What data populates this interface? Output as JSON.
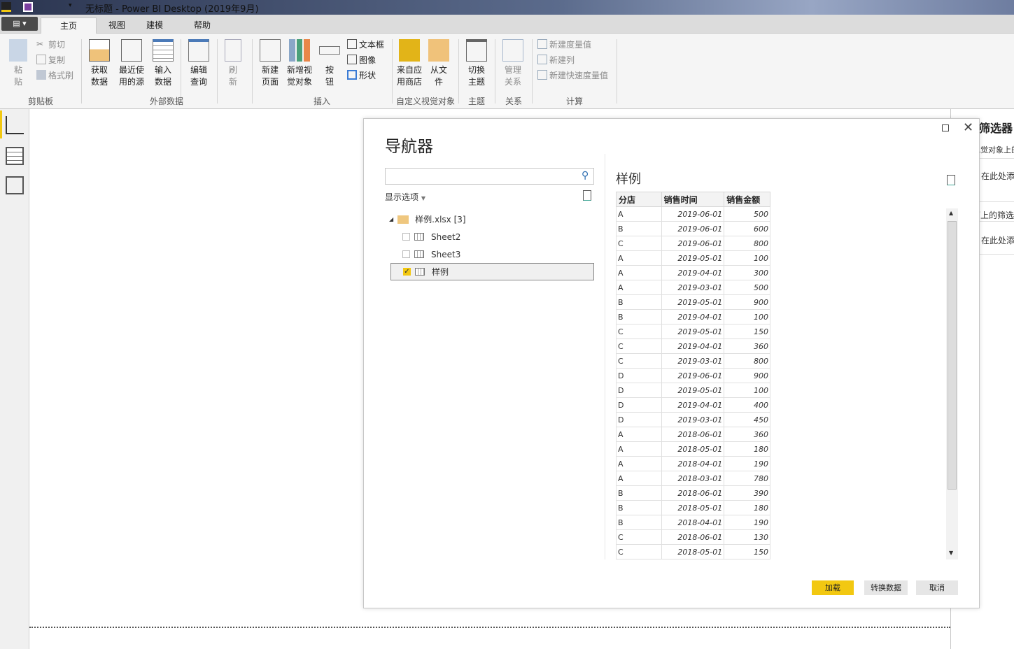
{
  "window": {
    "title": "无标题 - Power BI Desktop (2019年9月)"
  },
  "tabs": [
    "主页",
    "视图",
    "建模",
    "帮助"
  ],
  "ribbon": {
    "clipboard": {
      "paste": "粘贴",
      "cut": "剪切",
      "copy": "复制",
      "format_painter": "格式刷",
      "label": "剪贴板"
    },
    "external": {
      "get_data": "获取数据",
      "recent": "最近使用的源",
      "enter_data": "输入数据",
      "edit_query": "编辑查询",
      "refresh": "刷新",
      "label": "外部数据"
    },
    "insert": {
      "new_page": "新建页面",
      "new_visual": "新增视觉对象",
      "button": "按钮",
      "textbox": "文本框",
      "image": "图像",
      "shapes": "形状",
      "label": "插入"
    },
    "custom": {
      "from_store": "来自应用商店",
      "from_file": "从文件",
      "label": "自定义视觉对象"
    },
    "theme": {
      "switch": "切换主题",
      "label": "主题"
    },
    "relations": {
      "manage": "管理关系",
      "label": "关系"
    },
    "calc": {
      "new_measure": "新建度量值",
      "new_column": "新建列",
      "new_quick_measure": "新建快速度量值",
      "label": "计算"
    }
  },
  "filter_pane": {
    "title": "筛选器",
    "s1": "此视觉对象上的筛选器",
    "add1": "在此处添加",
    "s2": "此页面上的筛选器",
    "add2": "在此处添加"
  },
  "navigator": {
    "title": "导航器",
    "search_placeholder": "",
    "display_options": "显示选项",
    "file": "样例.xlsx [3]",
    "items": [
      {
        "label": "Sheet2",
        "checked": false
      },
      {
        "label": "Sheet3",
        "checked": false
      },
      {
        "label": "样例",
        "checked": true
      }
    ],
    "preview_title": "样例",
    "columns": [
      "分店",
      "销售时间",
      "销售金额"
    ],
    "rows": [
      [
        "A",
        "2019-06-01",
        "500"
      ],
      [
        "B",
        "2019-06-01",
        "600"
      ],
      [
        "C",
        "2019-06-01",
        "800"
      ],
      [
        "A",
        "2019-05-01",
        "100"
      ],
      [
        "A",
        "2019-04-01",
        "300"
      ],
      [
        "A",
        "2019-03-01",
        "500"
      ],
      [
        "B",
        "2019-05-01",
        "900"
      ],
      [
        "B",
        "2019-04-01",
        "100"
      ],
      [
        "C",
        "2019-05-01",
        "150"
      ],
      [
        "C",
        "2019-04-01",
        "360"
      ],
      [
        "C",
        "2019-03-01",
        "800"
      ],
      [
        "D",
        "2019-06-01",
        "900"
      ],
      [
        "D",
        "2019-05-01",
        "100"
      ],
      [
        "D",
        "2019-04-01",
        "400"
      ],
      [
        "D",
        "2019-03-01",
        "450"
      ],
      [
        "A",
        "2018-06-01",
        "360"
      ],
      [
        "A",
        "2018-05-01",
        "180"
      ],
      [
        "A",
        "2018-04-01",
        "190"
      ],
      [
        "A",
        "2018-03-01",
        "780"
      ],
      [
        "B",
        "2018-06-01",
        "390"
      ],
      [
        "B",
        "2018-05-01",
        "180"
      ],
      [
        "B",
        "2018-04-01",
        "190"
      ],
      [
        "C",
        "2018-06-01",
        "130"
      ],
      [
        "C",
        "2018-05-01",
        "150"
      ]
    ],
    "load": "加载",
    "transform": "转换数据",
    "cancel": "取消"
  },
  "colors": {
    "accent": "#f2c811"
  }
}
